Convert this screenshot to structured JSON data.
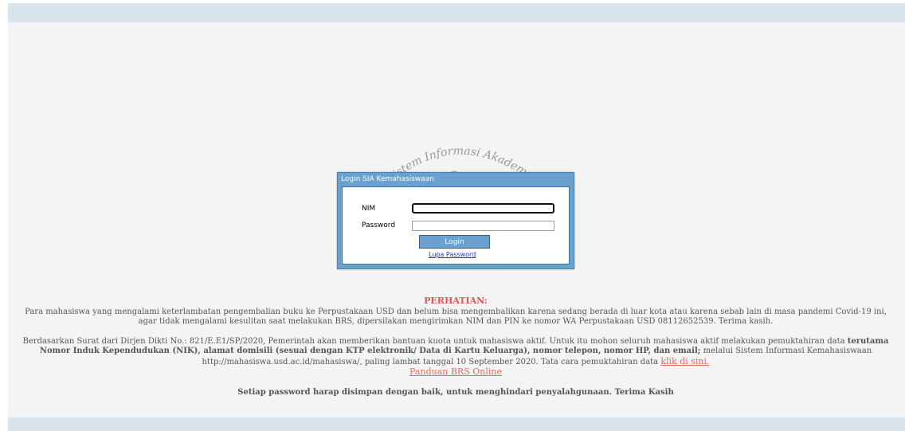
{
  "logo": {
    "arc_text": "Sistem Informasi Akademik"
  },
  "login": {
    "title": "Login SIA Kemahasiswaan",
    "nim_label": "NIM",
    "nim_value": "",
    "password_label": "Password",
    "password_value": "",
    "submit_label": "Login",
    "forgot_link": "Lupa Password"
  },
  "notice": {
    "heading": "PERHATIAN:",
    "para1": "Para mahasiswa yang mengalami keterlambatan pengembalian buku ke Perpustakaan USD dan belum bisa mengembalikan karena sedang berada di luar kota atau karena sebab lain di masa pandemi Covid-19 ini, agar tidak mengalami kesulitan saat melakukan BRS, dipersilakan mengirimkan NIM dan PIN ke nomor WA Perpustakaan USD 08112652539. Terima kasih.",
    "para2_start": "Berdasarkan Surat dari Dirjen Dikti No.: 821/E.E1/SP/2020, Pemerintah akan memberikan bantuan kuota untuk mahasiswa aktif. Untuk itu mohon seluruh mahasiswa aktif melakukan pemuktahiran data ",
    "para2_bold": "terutama Nomor Induk Kependudukan (NIK), alamat domisili (sesuai dengan KTP elektronik/ Data di Kartu Keluarga), nomor telepon, nomor HP, dan email;",
    "para2_end": " melalui Sistem Informasi Kemahasiswaan http://mahasiswa.usd.ac.id/mahasiswa/, paling lambat tanggal 10 September 2020. Tata cara pemuktahiran data ",
    "klik_link": "klik di sini.",
    "panduan_link": "Panduan BRS Online",
    "footer_note": "Setiap password harap disimpan dengan baik, untuk menghindari penyalahgunaan. Terima Kasih"
  }
}
